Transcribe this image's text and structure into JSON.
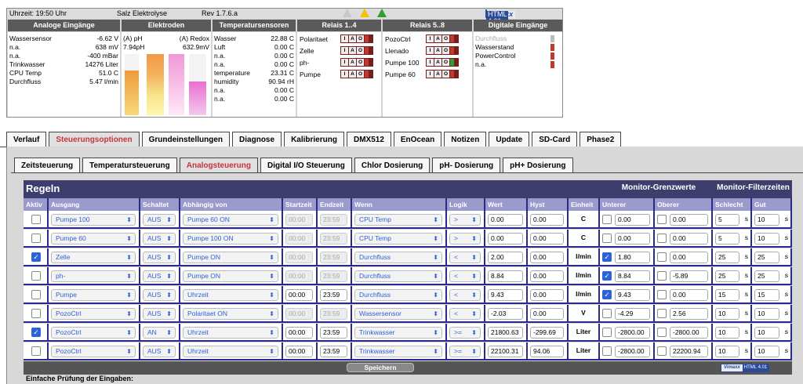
{
  "status": {
    "time": "Uhrzeit: 19:50 Uhr",
    "device": "Salz Elektrolyse",
    "revision": "Rev 1.7.6.a",
    "logo_left": "Vimaxx",
    "logo_right": "HTML 4.01",
    "headers": [
      "Analoge Eingänge",
      "Elektroden",
      "Temperatursensoren",
      "Relais 1..4",
      "Relais 5..8",
      "Digitale Eingänge"
    ],
    "analog_inputs": [
      {
        "label": "Wassersensor",
        "value": "-6.62 V"
      },
      {
        "label": "n.a.",
        "value": "638 mV"
      },
      {
        "label": "n.a.",
        "value": "-400 mBar"
      },
      {
        "label": "Trinkwasser",
        "value": "14276 Liter"
      },
      {
        "label": "CPU Temp",
        "value": "51.0 C"
      },
      {
        "label": "Durchfluss",
        "value": "5.47 l/min"
      }
    ],
    "electrodes": {
      "ph_label": "(A) pH",
      "ph_value": "7.94pH",
      "redox_label": "(A) Redox",
      "redox_value": "632.9mV",
      "ph_level": 0.73,
      "redox_level": 0.55
    },
    "temperature_sensors": [
      {
        "label": "Wasser",
        "value": "22.88 C"
      },
      {
        "label": "Luft",
        "value": "0.00 C"
      },
      {
        "label": "n.a.",
        "value": "0.00 C"
      },
      {
        "label": "n.a.",
        "value": "0.00 C"
      },
      {
        "label": "temperature",
        "value": "23.31 C"
      },
      {
        "label": "humidity",
        "value": "90.94 rH"
      },
      {
        "label": "n.a.",
        "value": "0.00 C"
      },
      {
        "label": "n.a.",
        "value": "0.00 C"
      }
    ],
    "relays_1_4": [
      {
        "label": "Polaritaet",
        "state": "#c0392b"
      },
      {
        "label": "Zelle",
        "state": "#c0392b"
      },
      {
        "label": "ph-",
        "state": "#c0392b"
      },
      {
        "label": "Pumpe",
        "state": "#c0392b"
      }
    ],
    "relays_5_8": [
      {
        "label": "PozoCtrl",
        "state": "#c0392b"
      },
      {
        "label": "Llenado",
        "state": "#c0392b"
      },
      {
        "label": "Pumpe 100",
        "state": "#2ea02e"
      },
      {
        "label": "Pumpe 60",
        "state": "#c0392b"
      }
    ],
    "relay_buttons": [
      "I",
      "A",
      "O"
    ],
    "digital_inputs": [
      {
        "label": "Durchfluss",
        "state": "#bbbbbb",
        "muted": true
      },
      {
        "label": "Wasserstand",
        "state": "#c0392b",
        "muted": false
      },
      {
        "label": "PowerControl",
        "state": "#c0392b",
        "muted": false
      },
      {
        "label": "n.a.",
        "state": "#c0392b",
        "muted": false
      }
    ]
  },
  "tabs": [
    "Verlauf",
    "Steuerungsoptionen",
    "Grundeinstellungen",
    "Diagnose",
    "Kalibrierung",
    "DMX512",
    "EnOcean",
    "Notizen",
    "Update",
    "SD-Card",
    "Phase2"
  ],
  "active_tab": 1,
  "subtabs": [
    "Zeitsteuerung",
    "Temperatursteuerung",
    "Analogsteuerung",
    "Digital I/O Steuerung",
    "Chlor Dosierung",
    "pH- Dosierung",
    "pH+ Dosierung"
  ],
  "active_subtab": 2,
  "rules": {
    "title": "Regeln",
    "monitor_limits": "Monitor-Grenzwerte",
    "monitor_filter": "Monitor-Filterzeiten",
    "columns": [
      "Aktiv",
      "Ausgang",
      "Schaltet",
      "Abhängig von",
      "Startzeit",
      "Endzeit",
      "Wenn",
      "Logik",
      "Wert",
      "Hyst",
      "Einheit",
      "Unterer",
      "Oberer",
      "Schlecht",
      "Gut"
    ],
    "rows": [
      {
        "active": false,
        "output": "Pumpe 100",
        "switch": "AUS",
        "depends": "Pumpe 60 ON",
        "start": "00:00",
        "start_dis": true,
        "end": "23:59",
        "end_dis": true,
        "when": "CPU Temp",
        "logic": ">",
        "value": "0.00",
        "hyst": "0.00",
        "unit": "C",
        "low_on": false,
        "low": "0.00",
        "high_on": false,
        "high": "0.00",
        "bad": "5",
        "good": "10"
      },
      {
        "active": false,
        "output": "Pumpe 60",
        "switch": "AUS",
        "depends": "Pumpe 100 ON",
        "start": "00:00",
        "start_dis": true,
        "end": "23:59",
        "end_dis": true,
        "when": "CPU Temp",
        "logic": ">",
        "value": "0.00",
        "hyst": "0.00",
        "unit": "C",
        "low_on": false,
        "low": "0.00",
        "high_on": false,
        "high": "0.00",
        "bad": "5",
        "good": "10"
      },
      {
        "active": true,
        "output": "Zelle",
        "switch": "AUS",
        "depends": "Pumpe ON",
        "start": "00:00",
        "start_dis": true,
        "end": "23:59",
        "end_dis": true,
        "when": "Durchfluss",
        "logic": "<",
        "value": "2.00",
        "hyst": "0.00",
        "unit": "l/min",
        "low_on": true,
        "low": "1.80",
        "high_on": false,
        "high": "0.00",
        "bad": "25",
        "good": "25"
      },
      {
        "active": false,
        "output": "ph-",
        "switch": "AUS",
        "depends": "Pumpe ON",
        "start": "00:00",
        "start_dis": true,
        "end": "23:59",
        "end_dis": true,
        "when": "Durchfluss",
        "logic": "<",
        "value": "8.84",
        "hyst": "0.00",
        "unit": "l/min",
        "low_on": true,
        "low": "8.84",
        "high_on": false,
        "high": "-5.89",
        "bad": "25",
        "good": "25"
      },
      {
        "active": false,
        "output": "Pumpe",
        "switch": "AUS",
        "depends": "Uhrzeit",
        "start": "00:00",
        "start_dis": false,
        "end": "23:59",
        "end_dis": false,
        "when": "Durchfluss",
        "logic": "<",
        "value": "9.43",
        "hyst": "0.00",
        "unit": "l/min",
        "low_on": true,
        "low": "9.43",
        "high_on": false,
        "high": "0.00",
        "bad": "15",
        "good": "15"
      },
      {
        "active": false,
        "output": "PozoCtrl",
        "switch": "AUS",
        "depends": "Polaritaet ON",
        "start": "00:00",
        "start_dis": true,
        "end": "23:59",
        "end_dis": true,
        "when": "Wassersensor",
        "logic": "<",
        "value": "-2.03",
        "hyst": "0.00",
        "unit": "V",
        "low_on": false,
        "low": "-4.29",
        "high_on": false,
        "high": "2.56",
        "bad": "10",
        "good": "10"
      },
      {
        "active": true,
        "output": "PozoCtrl",
        "switch": "AN",
        "depends": "Uhrzeit",
        "start": "00:00",
        "start_dis": false,
        "end": "23:59",
        "end_dis": false,
        "when": "Trinkwasser",
        "logic": ">=",
        "value": "21800.63",
        "hyst": "-299.69",
        "unit": "Liter",
        "low_on": false,
        "low": "-2800.00",
        "high_on": false,
        "high": "-2800.00",
        "bad": "10",
        "good": "10"
      },
      {
        "active": false,
        "output": "PozoCtrl",
        "switch": "AUS",
        "depends": "Uhrzeit",
        "start": "00:00",
        "start_dis": false,
        "end": "23:59",
        "end_dis": false,
        "when": "Trinkwasser",
        "logic": ">=",
        "value": "22100.31",
        "hyst": "94.06",
        "unit": "Liter",
        "low_on": false,
        "low": "-2800.00",
        "high_on": false,
        "high": "22200.94",
        "bad": "10",
        "good": "10"
      }
    ],
    "seconds_suffix": "s",
    "save_label": "Speichern"
  },
  "footer_note": "Einfache Prüfung der Eingaben:"
}
